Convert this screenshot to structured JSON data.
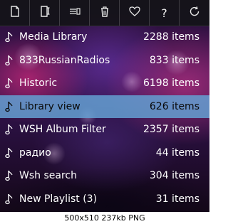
{
  "toolbar": {
    "buttons": [
      {
        "icon": "new-file-icon"
      },
      {
        "icon": "rename-file-icon"
      },
      {
        "icon": "filter-icon"
      },
      {
        "icon": "trash-icon"
      },
      {
        "icon": "heart-icon"
      },
      {
        "icon": "help-icon",
        "label": "?"
      },
      {
        "icon": "refresh-icon"
      }
    ]
  },
  "playlists": [
    {
      "name": "Media Library",
      "count": "2288 items"
    },
    {
      "name": "833RussianRadios",
      "count": "833 items"
    },
    {
      "name": "Historic",
      "count": "6198 items"
    },
    {
      "name": "Library view",
      "count": "626 items",
      "selected": true
    },
    {
      "name": "WSH Album Filter",
      "count": "2357 items"
    },
    {
      "name": "радио",
      "count": "44 items"
    },
    {
      "name": "Wsh search",
      "count": "304 items"
    },
    {
      "name": "New Playlist (3)",
      "count": "31 items"
    }
  ],
  "caption": "500x510 237kb PNG",
  "colors": {
    "selected_row": "#64a0d2",
    "toolbar_bg": "#141418",
    "text": "#ffffff"
  }
}
